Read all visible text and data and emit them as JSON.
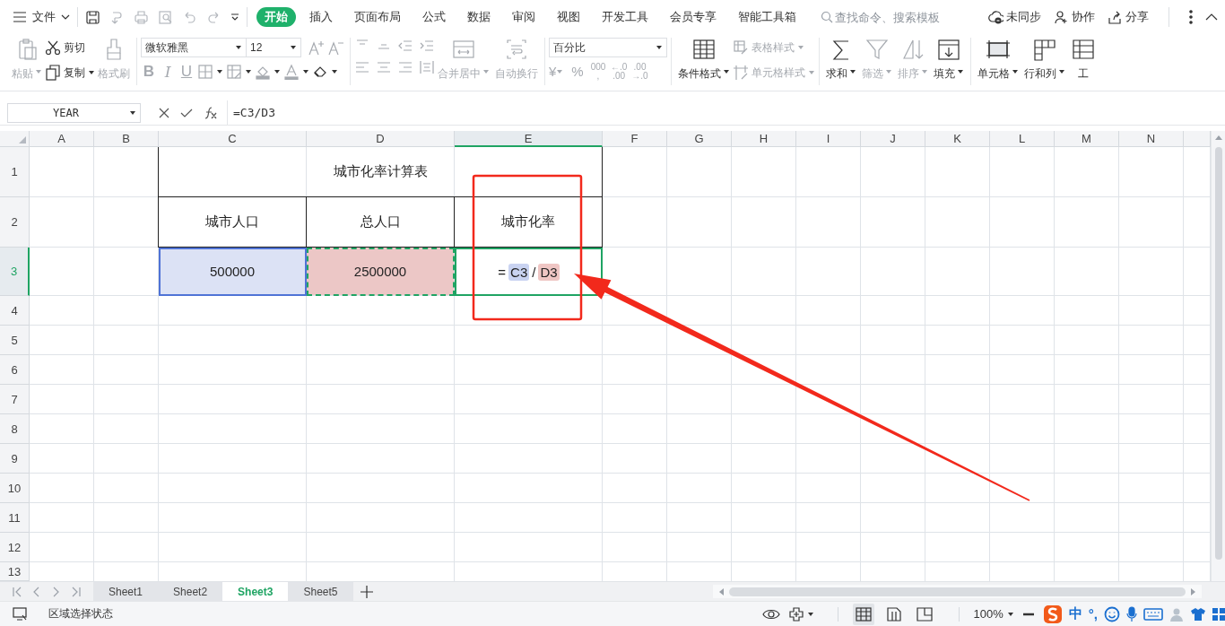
{
  "menu": {
    "label": "文件"
  },
  "tabs": [
    {
      "label": "开始",
      "selected": true
    },
    {
      "label": "插入",
      "selected": false
    },
    {
      "label": "页面布局",
      "selected": false
    },
    {
      "label": "公式",
      "selected": false
    },
    {
      "label": "数据",
      "selected": false
    },
    {
      "label": "审阅",
      "selected": false
    },
    {
      "label": "视图",
      "selected": false
    },
    {
      "label": "开发工具",
      "selected": false
    },
    {
      "label": "会员专享",
      "selected": false
    },
    {
      "label": "智能工具箱",
      "selected": false
    }
  ],
  "search": {
    "placeholder": "查找命令、搜索模板"
  },
  "actions": [
    "未同步",
    "协作",
    "分享"
  ],
  "ribbon": {
    "clipboard": [
      {
        "label": "粘贴",
        "disabled": true
      },
      {
        "label": "剪切",
        "disabled": false
      },
      {
        "label": "复制",
        "disabled": false
      },
      {
        "label": "格式刷",
        "disabled": true
      }
    ],
    "font": {
      "name": "微软雅黑",
      "size": "12",
      "format_buttons": [
        "B",
        "I",
        "U"
      ]
    },
    "alignment": [
      {
        "label": "合并居中",
        "disabled": true
      },
      {
        "label": "自动换行",
        "disabled": true
      }
    ],
    "number": {
      "format": "百分比",
      "buttons": [
        {
          "lines": [
            "¥"
          ]
        },
        {
          "lines": [
            "%"
          ]
        },
        {
          "lines": [
            "000",
            ","
          ]
        },
        {
          "lines": [
            "←.0",
            ".00"
          ]
        },
        {
          "lines": [
            ".00",
            "→.0"
          ]
        }
      ]
    },
    "styles": [
      {
        "label": "条件格式",
        "disabled": false
      },
      {
        "label": "表格样式",
        "disabled": true
      },
      {
        "label": "单元格样式",
        "disabled": true
      }
    ],
    "editing": [
      {
        "label": "求和",
        "disabled": false
      },
      {
        "label": "筛选",
        "disabled": true
      },
      {
        "label": "排序",
        "disabled": true
      },
      {
        "label": "填充",
        "disabled": false
      }
    ],
    "cells": [
      {
        "label": "单元格",
        "disabled": false
      },
      {
        "label": "行和列",
        "disabled": false
      },
      {
        "label": "工",
        "disabled": false
      }
    ]
  },
  "formula_bar": {
    "name_box": "YEAR",
    "formula": "=C3/D3"
  },
  "sheet": {
    "columns": [
      {
        "label": "A",
        "selected": false
      },
      {
        "label": "B",
        "selected": false
      },
      {
        "label": "C",
        "selected": false
      },
      {
        "label": "D",
        "selected": false
      },
      {
        "label": "E",
        "selected": true
      },
      {
        "label": "F",
        "selected": false
      },
      {
        "label": "G",
        "selected": false
      },
      {
        "label": "H",
        "selected": false
      },
      {
        "label": "I",
        "selected": false
      },
      {
        "label": "J",
        "selected": false
      },
      {
        "label": "K",
        "selected": false
      },
      {
        "label": "L",
        "selected": false
      },
      {
        "label": "M",
        "selected": false
      },
      {
        "label": "N",
        "selected": false
      }
    ],
    "rows": [
      {
        "label": "1",
        "selected": false
      },
      {
        "label": "2",
        "selected": false
      },
      {
        "label": "3",
        "selected": true
      },
      {
        "label": "4",
        "selected": false
      },
      {
        "label": "5",
        "selected": false
      },
      {
        "label": "6",
        "selected": false
      },
      {
        "label": "7",
        "selected": false
      },
      {
        "label": "8",
        "selected": false
      },
      {
        "label": "9",
        "selected": false
      },
      {
        "label": "10",
        "selected": false
      },
      {
        "label": "11",
        "selected": false
      },
      {
        "label": "12",
        "selected": false
      },
      {
        "label": "13",
        "selected": false
      }
    ]
  },
  "table": {
    "title": "城市化率计算表",
    "headers": [
      "城市人口",
      "总人口",
      "城市化率"
    ],
    "values": [
      {
        "text": "500000",
        "color": "#dce2f5",
        "copy_marquee": false
      },
      {
        "text": "2500000",
        "color": "#ecc7c6",
        "copy_marquee": true
      }
    ],
    "editing_cell": [
      {
        "text": "="
      },
      {
        "text": "C3",
        "color": "#c9d3f1"
      },
      {
        "text": "/"
      },
      {
        "text": "D3",
        "color": "#efc6c4"
      }
    ]
  },
  "sheet_tabs": [
    {
      "label": "Sheet1",
      "selected": false
    },
    {
      "label": "Sheet2",
      "selected": false
    },
    {
      "label": "Sheet3",
      "selected": true
    },
    {
      "label": "Sheet5",
      "selected": false
    }
  ],
  "status": {
    "text": "区域选择状态",
    "views": [
      {
        "selected": true
      },
      {
        "selected": false
      },
      {
        "selected": false
      }
    ],
    "zoom": "100%",
    "ime": [
      "中",
      "°,"
    ]
  }
}
